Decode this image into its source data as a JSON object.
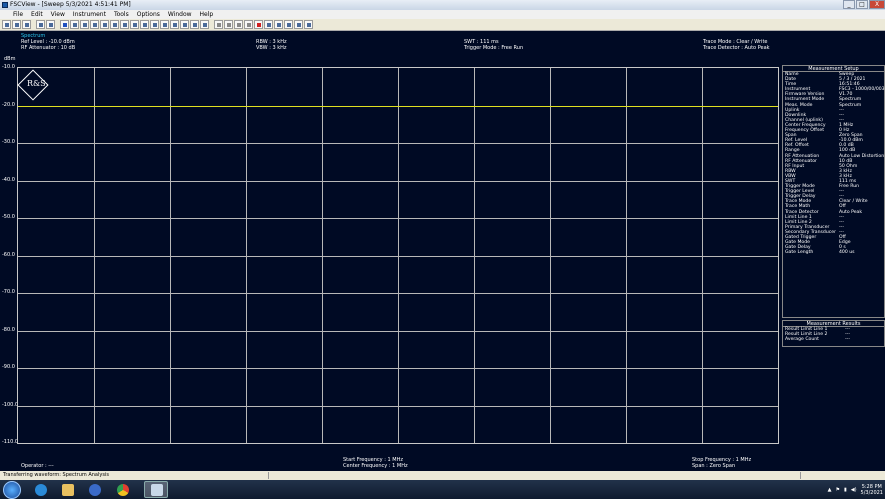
{
  "window": {
    "title": "FSCView - [Sweep  5/3/2021  4:51:41 PM]",
    "buttons": {
      "minimize": "_",
      "maximize": "□",
      "close": "X"
    }
  },
  "menu": [
    "File",
    "Edit",
    "View",
    "Instrument",
    "Tools",
    "Options",
    "Window",
    "Help"
  ],
  "header": {
    "mode": "Spectrum",
    "ref_level": "Ref Level : -10.0 dBm",
    "rf_att": "RF Attenuator :  10   dB",
    "rbw": "RBW : 3 kHz",
    "vbw": "VBW : 3 kHz",
    "swt": "SWT :               111 ms",
    "trigger": "Trigger Mode : Free Run",
    "trace_mode": "Trace Mode : Clear / Write",
    "trace_det": "Trace Detector : Auto Peak",
    "unit": "dBm"
  },
  "plot": {
    "y_labels": [
      "-10.0",
      "-20.0",
      "-30.0",
      "-40.0",
      "-50.0",
      "-60.0",
      "-70.0",
      "-80.0",
      "-90.0",
      "-100.0",
      "-110.0"
    ],
    "trace_level_dbm": -20.0,
    "ylim": [
      -110,
      -10
    ],
    "grid_divisions": 10
  },
  "setup": {
    "title": "Measurement Setup",
    "rows": [
      [
        "Name",
        "Sweep"
      ],
      [
        "Date",
        "5 / 3 / 2021"
      ],
      [
        "Time",
        "16:51:46"
      ],
      [
        "Instrument",
        "FSC3 - 1000/00/003"
      ],
      [
        "Firmware Version",
        "V1.70"
      ],
      [
        "Instrument Mode",
        "Spectrum"
      ],
      [
        "Meas. Mode",
        "Spectrum"
      ],
      [
        "Uplink",
        "---"
      ],
      [
        "Downlink",
        "---"
      ],
      [
        "Channel (uplink)",
        "---"
      ],
      [
        "Center Frequency",
        "1      MHz"
      ],
      [
        "Frequency Offset",
        "0      Hz"
      ],
      [
        "Span",
        "Zero Span"
      ],
      [
        "Ref. Level",
        "-10.0 dBm"
      ],
      [
        "Ref. Offset",
        "0.0 dB"
      ],
      [
        "Range",
        "100    dB"
      ],
      [
        "RF Attenuation",
        "Auto Low Distortion"
      ],
      [
        "RF Attenuator",
        "10    dB"
      ],
      [
        "RF Input",
        "50 Ohm"
      ],
      [
        "RBW",
        "3      kHz"
      ],
      [
        "VBW",
        "3      kHz"
      ],
      [
        "SWT",
        "111    ms"
      ],
      [
        "Trigger Mode",
        "Free Run"
      ],
      [
        "Trigger Level",
        "---"
      ],
      [
        "Trigger Delay",
        "---"
      ],
      [
        "Trace Mode",
        "Clear / Write"
      ],
      [
        "Trace Math",
        "Off"
      ],
      [
        "Trace Detector",
        "Auto Peak"
      ],
      [
        "Limit Line 1",
        "---"
      ],
      [
        "Limit Line 2",
        "---"
      ],
      [
        "Primary Transducer",
        "---"
      ],
      [
        "Secondary Transducer",
        "---"
      ],
      [
        "Gated Trigger",
        "Off"
      ],
      [
        "Gate Mode",
        "Edge"
      ],
      [
        "Gate Delay",
        "0      s"
      ],
      [
        "Gate Length",
        "400    us"
      ]
    ]
  },
  "results": {
    "title": "Measurement Results",
    "rows": [
      [
        "Result Limit Line 1",
        "---"
      ],
      [
        "Result Limit Line 2",
        "---"
      ],
      [
        "Average Count",
        "---"
      ]
    ]
  },
  "bottom": {
    "operator": "Operator : ---",
    "start_freq": "Start Frequency :  1 MHz",
    "center_freq": "Center Frequency : 1 MHz",
    "stop_freq": "Stop Frequency :             1 MHz",
    "span": "Span                       : Zero Span"
  },
  "status": {
    "text": "Transferring waveform: Spectrum Analysis"
  },
  "taskbar": {
    "time": "5:28 PM",
    "date": "5/3/2021"
  }
}
